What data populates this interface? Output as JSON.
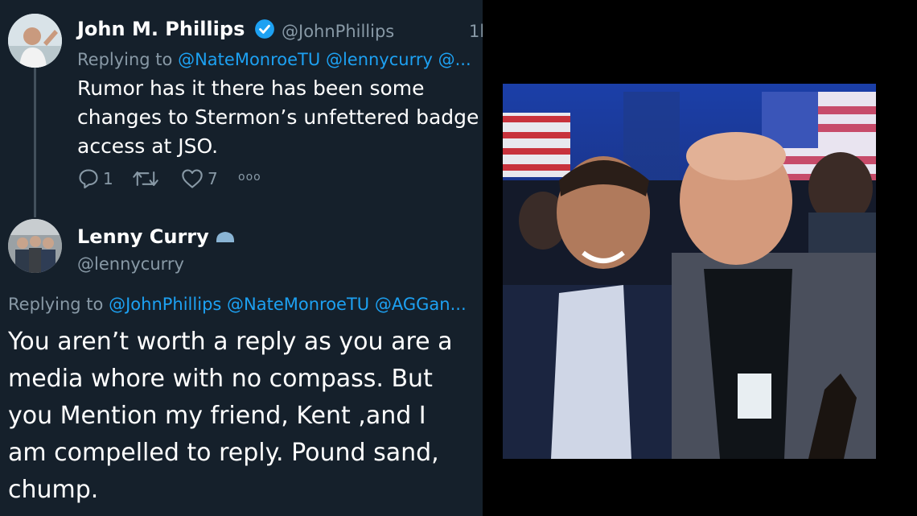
{
  "tweet1": {
    "author_name": "John M. Phillips",
    "handle": "@JohnPhillips",
    "time_fragment": "1l",
    "replying_to_label": "Replying to",
    "replying_to": [
      "@NateMonroeTU",
      "@lennycurry",
      "@..."
    ],
    "text": "Rumor has it there has been some\nchanges to Stermon’s unfettered badge\naccess at JSO.",
    "actions": {
      "reply_count": "1",
      "retweet_count": "",
      "like_count": "7",
      "more": "ooo"
    }
  },
  "tweet2": {
    "author_name": "Lenny Curry",
    "handle": "@lennycurry",
    "replying_to_label": "Replying to",
    "replying_to": [
      "@JohnPhillips",
      "@NateMonroeTU",
      "@AGGan..."
    ],
    "text": "You aren’t worth a reply as you are a\nmedia whore with no compass. But\nyou Mention my friend, Kent ,and I\nam compelled to reply. Pound sand,\nchump."
  },
  "colors": {
    "background": "#15202b",
    "text": "#ffffff",
    "muted": "#8899a6",
    "link": "#1da1f2",
    "verified": "#1da1f2",
    "gov_badge": "#8ab4d4"
  },
  "photo": {
    "description_icon": "selfie-photo"
  }
}
